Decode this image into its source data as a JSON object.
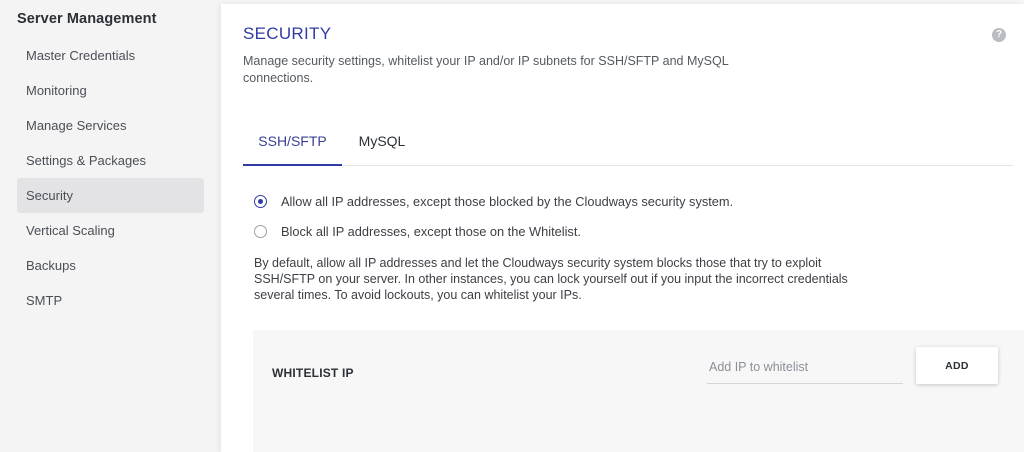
{
  "sidebar": {
    "title": "Server Management",
    "items": [
      {
        "label": "Master Credentials"
      },
      {
        "label": "Monitoring"
      },
      {
        "label": "Manage Services"
      },
      {
        "label": "Settings & Packages"
      },
      {
        "label": "Security",
        "active": true
      },
      {
        "label": "Vertical Scaling"
      },
      {
        "label": "Backups"
      },
      {
        "label": "SMTP"
      }
    ]
  },
  "main": {
    "title": "SECURITY",
    "help_icon": "question-circle-icon",
    "description": "Manage security settings, whitelist your IP and/or IP subnets for SSH/SFTP and MySQL connections.",
    "tabs": [
      {
        "label": "SSH/SFTP",
        "active": true
      },
      {
        "label": "MySQL",
        "active": false
      }
    ],
    "options": [
      {
        "label": "Allow all IP addresses, except those blocked by the Cloudways security system.",
        "checked": true
      },
      {
        "label": "Block all IP addresses, except those on the Whitelist.",
        "checked": false
      }
    ],
    "info": "By default, allow all IP addresses and let the Cloudways security system blocks those that try to exploit SSH/SFTP on your server. In other instances, you can lock yourself out if you input the incorrect credentials several times. To avoid lockouts, you can whitelist your IPs.",
    "whitelist": {
      "title": "WHITELIST IP",
      "input_value": "",
      "input_placeholder": "Add IP to whitelist",
      "add_label": "ADD"
    }
  },
  "colors": {
    "accent": "#2f3ba0",
    "sidebar_bg": "#f4f4f4",
    "sidebar_active_bg": "#e3e3e5",
    "panel_bg": "#f7f7f8"
  }
}
